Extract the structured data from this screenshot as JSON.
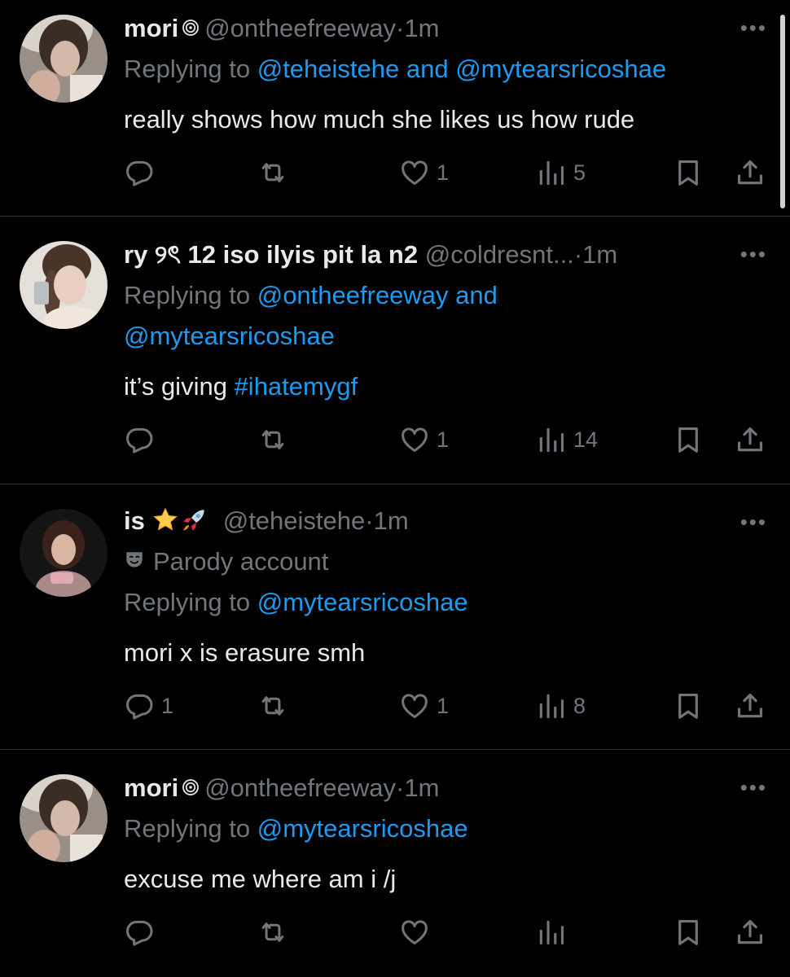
{
  "colors": {
    "background": "#000000",
    "text": "#e7e9ea",
    "muted": "#71767b",
    "link": "#1d9bf0",
    "divider": "#2f3336"
  },
  "tweets": [
    {
      "display_name": "mori",
      "handle": "@ontheefreeway",
      "sep": "·",
      "time": "1m",
      "replying_prefix": "Replying to ",
      "replying_line1_links": [
        "@teheistehe",
        "@mytearsricoshae"
      ],
      "and": " and ",
      "text": "really shows how much she likes us how rude",
      "counts": {
        "reply": "",
        "retweet": "",
        "like": "1",
        "views": "5"
      },
      "icons": [
        "reply-icon",
        "retweet-icon",
        "heart-icon",
        "views-icon",
        "bookmark-icon",
        "share-icon"
      ]
    },
    {
      "display_name": "ry ୨ৎ 12 iso ilyis pit la n2",
      "handle": "@coldresnt...",
      "sep": "·",
      "time": "1m",
      "replying_prefix": "Replying to ",
      "replying_line1_link": "@ontheefreeway",
      "and": " and",
      "replying_line2_link": "@mytearsricoshae",
      "text_before": "it’s giving ",
      "hashtag": "#ihatemygf",
      "counts": {
        "reply": "",
        "retweet": "",
        "like": "1",
        "views": "14"
      }
    },
    {
      "display_name": "is",
      "emojis": [
        "star-emoji",
        "rocket-emoji"
      ],
      "handle": "@teheistehe",
      "sep": "·",
      "time": "1m",
      "parody_label": "Parody account",
      "replying_prefix": "Replying to ",
      "replying_link": "@mytearsricoshae",
      "text": "mori x is erasure smh",
      "counts": {
        "reply": "1",
        "retweet": "",
        "like": "1",
        "views": "8"
      }
    },
    {
      "display_name": "mori",
      "handle": "@ontheefreeway",
      "sep": "·",
      "time": "1m",
      "replying_prefix": "Replying to ",
      "replying_link": "@mytearsricoshae",
      "text": "excuse me where am i /j",
      "counts": {
        "reply": "",
        "retweet": "",
        "like": "",
        "views": ""
      }
    }
  ],
  "more_label": "•••"
}
